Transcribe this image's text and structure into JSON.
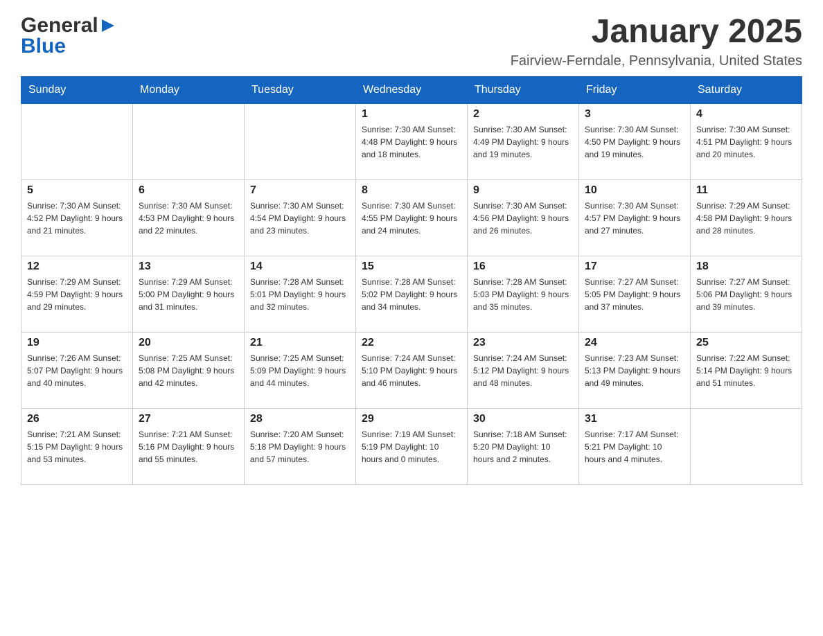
{
  "header": {
    "logo_general": "General",
    "logo_blue": "Blue",
    "month_title": "January 2025",
    "location": "Fairview-Ferndale, Pennsylvania, United States"
  },
  "days_of_week": [
    "Sunday",
    "Monday",
    "Tuesday",
    "Wednesday",
    "Thursday",
    "Friday",
    "Saturday"
  ],
  "weeks": [
    [
      {
        "day": "",
        "info": ""
      },
      {
        "day": "",
        "info": ""
      },
      {
        "day": "",
        "info": ""
      },
      {
        "day": "1",
        "info": "Sunrise: 7:30 AM\nSunset: 4:48 PM\nDaylight: 9 hours\nand 18 minutes."
      },
      {
        "day": "2",
        "info": "Sunrise: 7:30 AM\nSunset: 4:49 PM\nDaylight: 9 hours\nand 19 minutes."
      },
      {
        "day": "3",
        "info": "Sunrise: 7:30 AM\nSunset: 4:50 PM\nDaylight: 9 hours\nand 19 minutes."
      },
      {
        "day": "4",
        "info": "Sunrise: 7:30 AM\nSunset: 4:51 PM\nDaylight: 9 hours\nand 20 minutes."
      }
    ],
    [
      {
        "day": "5",
        "info": "Sunrise: 7:30 AM\nSunset: 4:52 PM\nDaylight: 9 hours\nand 21 minutes."
      },
      {
        "day": "6",
        "info": "Sunrise: 7:30 AM\nSunset: 4:53 PM\nDaylight: 9 hours\nand 22 minutes."
      },
      {
        "day": "7",
        "info": "Sunrise: 7:30 AM\nSunset: 4:54 PM\nDaylight: 9 hours\nand 23 minutes."
      },
      {
        "day": "8",
        "info": "Sunrise: 7:30 AM\nSunset: 4:55 PM\nDaylight: 9 hours\nand 24 minutes."
      },
      {
        "day": "9",
        "info": "Sunrise: 7:30 AM\nSunset: 4:56 PM\nDaylight: 9 hours\nand 26 minutes."
      },
      {
        "day": "10",
        "info": "Sunrise: 7:30 AM\nSunset: 4:57 PM\nDaylight: 9 hours\nand 27 minutes."
      },
      {
        "day": "11",
        "info": "Sunrise: 7:29 AM\nSunset: 4:58 PM\nDaylight: 9 hours\nand 28 minutes."
      }
    ],
    [
      {
        "day": "12",
        "info": "Sunrise: 7:29 AM\nSunset: 4:59 PM\nDaylight: 9 hours\nand 29 minutes."
      },
      {
        "day": "13",
        "info": "Sunrise: 7:29 AM\nSunset: 5:00 PM\nDaylight: 9 hours\nand 31 minutes."
      },
      {
        "day": "14",
        "info": "Sunrise: 7:28 AM\nSunset: 5:01 PM\nDaylight: 9 hours\nand 32 minutes."
      },
      {
        "day": "15",
        "info": "Sunrise: 7:28 AM\nSunset: 5:02 PM\nDaylight: 9 hours\nand 34 minutes."
      },
      {
        "day": "16",
        "info": "Sunrise: 7:28 AM\nSunset: 5:03 PM\nDaylight: 9 hours\nand 35 minutes."
      },
      {
        "day": "17",
        "info": "Sunrise: 7:27 AM\nSunset: 5:05 PM\nDaylight: 9 hours\nand 37 minutes."
      },
      {
        "day": "18",
        "info": "Sunrise: 7:27 AM\nSunset: 5:06 PM\nDaylight: 9 hours\nand 39 minutes."
      }
    ],
    [
      {
        "day": "19",
        "info": "Sunrise: 7:26 AM\nSunset: 5:07 PM\nDaylight: 9 hours\nand 40 minutes."
      },
      {
        "day": "20",
        "info": "Sunrise: 7:25 AM\nSunset: 5:08 PM\nDaylight: 9 hours\nand 42 minutes."
      },
      {
        "day": "21",
        "info": "Sunrise: 7:25 AM\nSunset: 5:09 PM\nDaylight: 9 hours\nand 44 minutes."
      },
      {
        "day": "22",
        "info": "Sunrise: 7:24 AM\nSunset: 5:10 PM\nDaylight: 9 hours\nand 46 minutes."
      },
      {
        "day": "23",
        "info": "Sunrise: 7:24 AM\nSunset: 5:12 PM\nDaylight: 9 hours\nand 48 minutes."
      },
      {
        "day": "24",
        "info": "Sunrise: 7:23 AM\nSunset: 5:13 PM\nDaylight: 9 hours\nand 49 minutes."
      },
      {
        "day": "25",
        "info": "Sunrise: 7:22 AM\nSunset: 5:14 PM\nDaylight: 9 hours\nand 51 minutes."
      }
    ],
    [
      {
        "day": "26",
        "info": "Sunrise: 7:21 AM\nSunset: 5:15 PM\nDaylight: 9 hours\nand 53 minutes."
      },
      {
        "day": "27",
        "info": "Sunrise: 7:21 AM\nSunset: 5:16 PM\nDaylight: 9 hours\nand 55 minutes."
      },
      {
        "day": "28",
        "info": "Sunrise: 7:20 AM\nSunset: 5:18 PM\nDaylight: 9 hours\nand 57 minutes."
      },
      {
        "day": "29",
        "info": "Sunrise: 7:19 AM\nSunset: 5:19 PM\nDaylight: 10 hours\nand 0 minutes."
      },
      {
        "day": "30",
        "info": "Sunrise: 7:18 AM\nSunset: 5:20 PM\nDaylight: 10 hours\nand 2 minutes."
      },
      {
        "day": "31",
        "info": "Sunrise: 7:17 AM\nSunset: 5:21 PM\nDaylight: 10 hours\nand 4 minutes."
      },
      {
        "day": "",
        "info": ""
      }
    ]
  ]
}
